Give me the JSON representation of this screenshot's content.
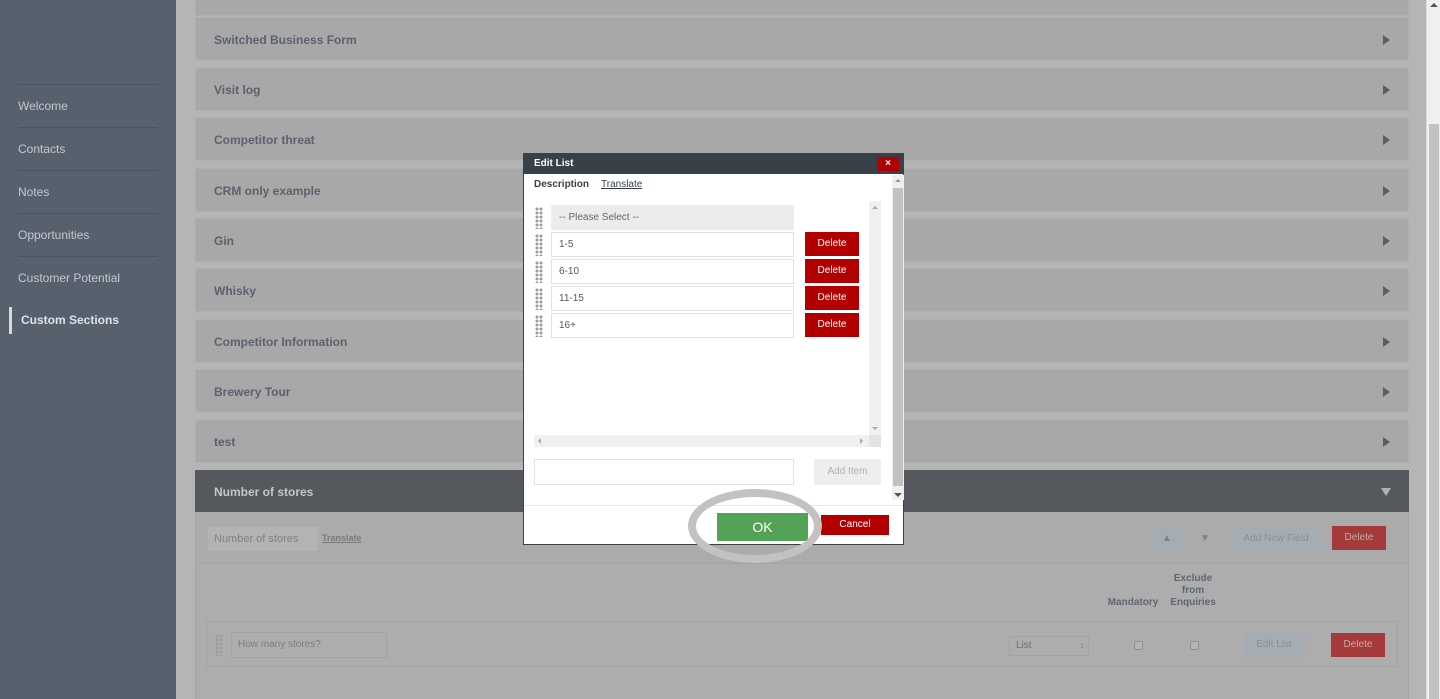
{
  "sidebar": {
    "items": [
      {
        "label": "Welcome"
      },
      {
        "label": "Contacts"
      },
      {
        "label": "Notes"
      },
      {
        "label": "Opportunities"
      },
      {
        "label": "Customer Potential"
      },
      {
        "label": "Custom Sections",
        "active": true
      }
    ]
  },
  "sections": [
    {
      "title": "Switched Business Form"
    },
    {
      "title": "Visit log"
    },
    {
      "title": "Competitor threat"
    },
    {
      "title": "CRM only example"
    },
    {
      "title": "Gin"
    },
    {
      "title": "Whisky"
    },
    {
      "title": "Competitor Information"
    },
    {
      "title": "Brewery Tour"
    },
    {
      "title": "test"
    },
    {
      "title": "Number of stores",
      "open": true
    }
  ],
  "open_section": {
    "name_value": "Number of  stores",
    "translate_label": "Translate",
    "move_up_label": "▲",
    "move_down_label": "▼",
    "add_field_label": "Add New Field",
    "delete_label": "Delete",
    "columns": {
      "mandatory": "Mandatory",
      "exclude": "Exclude from Enquiries"
    },
    "fields": [
      {
        "label_placeholder": "How many stores?",
        "type": "List",
        "mandatory": false,
        "exclude": false,
        "edit_list_label": "Edit List",
        "delete_label": "Delete"
      }
    ]
  },
  "modal": {
    "title": "Edit List",
    "close_icon": "×",
    "tabs": {
      "description": "Description",
      "translate": "Translate"
    },
    "placeholder_item": "-- Please Select --",
    "items": [
      {
        "value": "1-5"
      },
      {
        "value": "6-10"
      },
      {
        "value": "11-15"
      },
      {
        "value": "16+"
      }
    ],
    "delete_label": "Delete",
    "new_item_value": "",
    "add_item_label": "Add Item",
    "ok_label": "OK",
    "cancel_label": "Cancel"
  }
}
